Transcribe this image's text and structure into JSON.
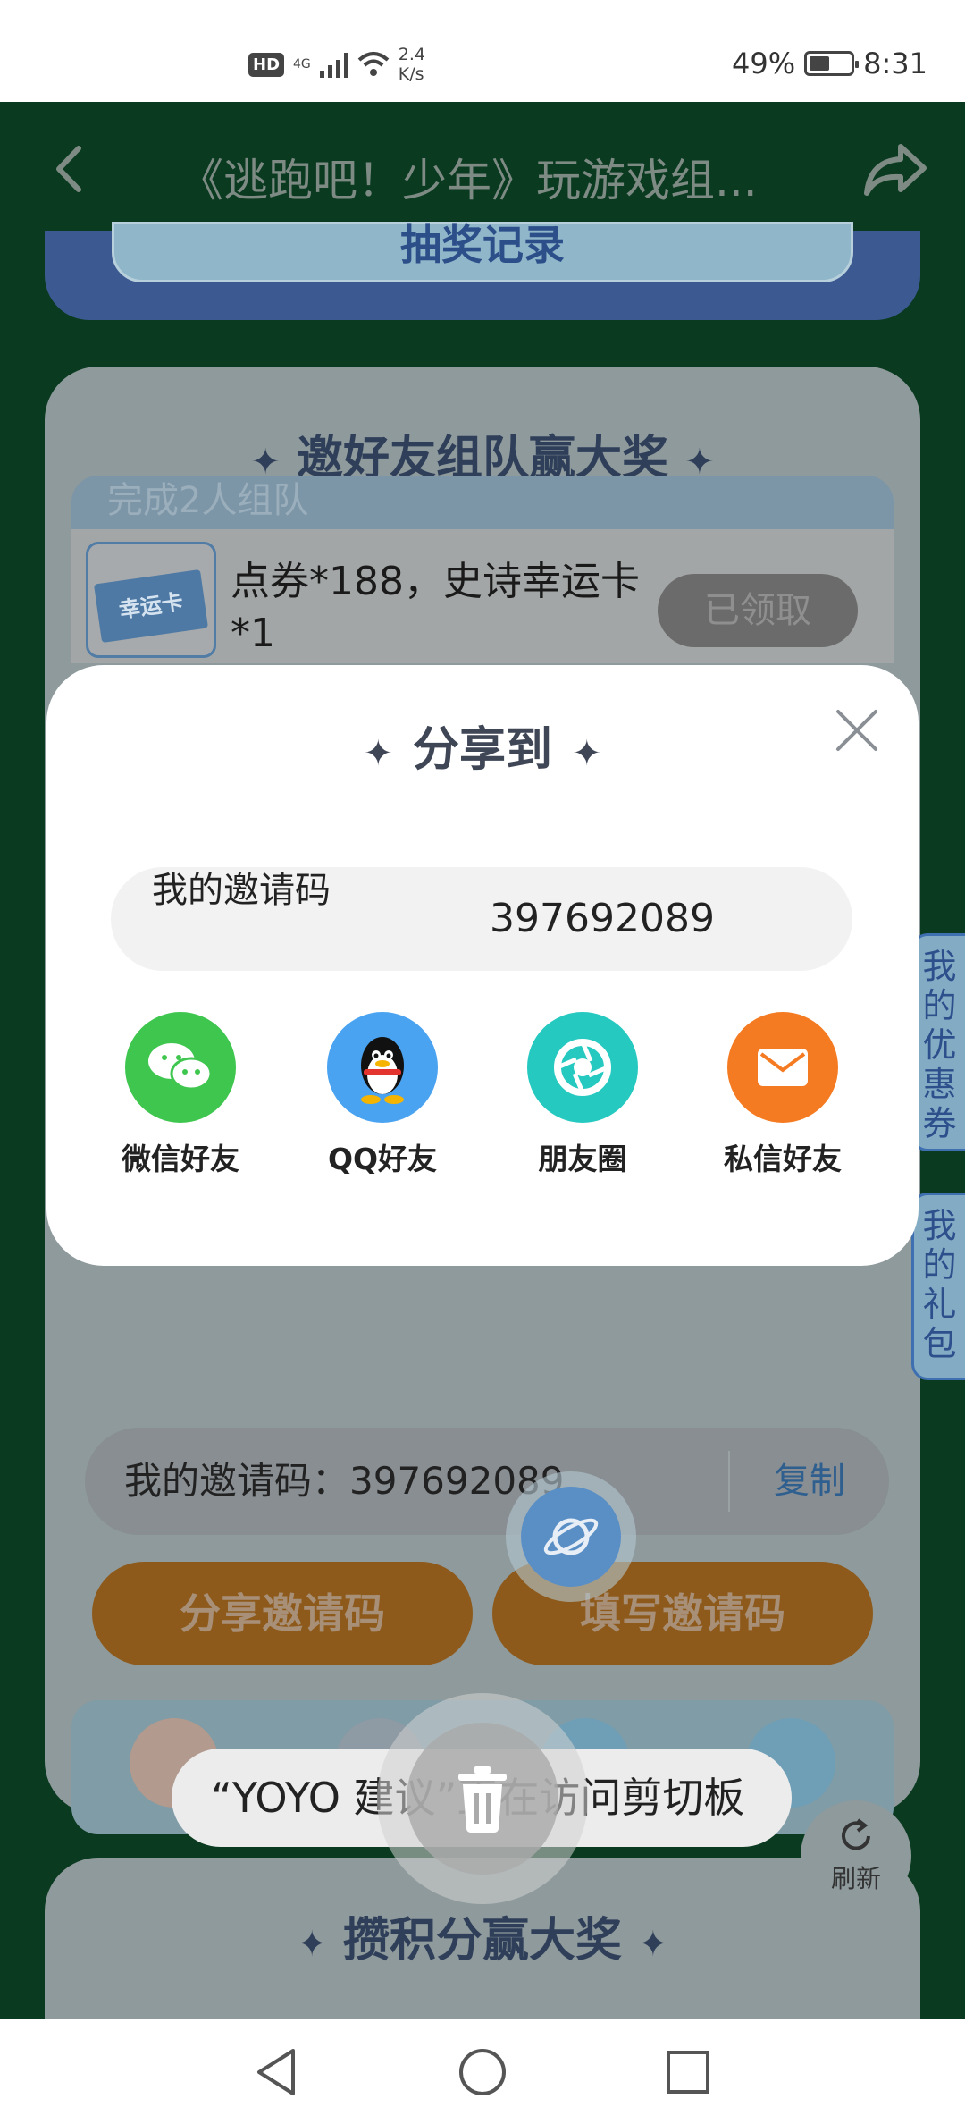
{
  "status_bar": {
    "hd": "HD",
    "network": "4G",
    "speed_value": "2.4",
    "speed_unit": "K/s",
    "battery": "49%",
    "time": "8:31",
    "battery_level": 0.49
  },
  "header": {
    "title": "《逃跑吧！少年》玩游戏组..."
  },
  "background": {
    "lottery_button": "抽奖记录",
    "invite_section_title": "邀好友组队赢大奖",
    "team_banner": "完成2人组队",
    "reward_text": "点券*188，史诗幸运卡*1",
    "luck_card_label": "幸运卡",
    "claimed_button": "已领取",
    "invite_code_row": "我的邀请码：397692089",
    "copy_button": "复制",
    "share_code_button": "分享邀请码",
    "fill_code_button": "填写邀请码",
    "points_section_title": "攒积分赢大奖"
  },
  "side_tabs": {
    "coupons": "我的优惠券",
    "gifts": "我的礼包"
  },
  "modal": {
    "title": "分享到",
    "code_label": "我的邀请码",
    "code_value": "397692089",
    "share_options": [
      {
        "label": "微信好友",
        "icon": "wechat-icon",
        "color": "#3fc64f"
      },
      {
        "label": "QQ好友",
        "icon": "qq-icon",
        "color": "#4aa3f0"
      },
      {
        "label": "朋友圈",
        "icon": "moments-icon",
        "color": "#25c9c0"
      },
      {
        "label": "私信好友",
        "icon": "mail-icon",
        "color": "#f57b22"
      }
    ]
  },
  "toast": {
    "text": "“YOYO 建议”正在访问剪切板"
  },
  "refresh": {
    "label": "刷新"
  },
  "colors": {
    "page_bg": "#0a3a1f",
    "modal_bg": "#ffffff",
    "accent_blue": "#3e6fb0"
  }
}
